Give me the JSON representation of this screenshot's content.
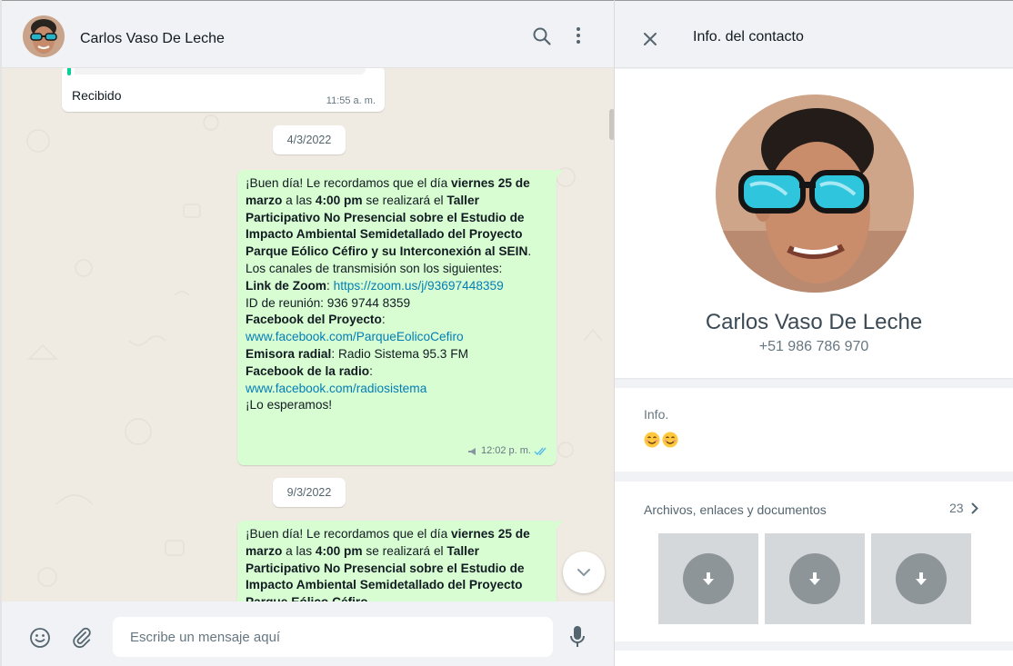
{
  "chat": {
    "contact_name": "Carlos Vaso De Leche",
    "incoming": {
      "text": "Recibido",
      "time": "11:55 a. m."
    },
    "date_chips": [
      "4/3/2022",
      "9/3/2022"
    ],
    "message1": {
      "p1": "¡Buen día! Le recordamos que el día ",
      "b1": "viernes 25 de marzo",
      "p2": " a las ",
      "b2": "4:00 pm",
      "p3": " se realizará el ",
      "b3": "Taller Participativo No Presencial sobre el Estudio de Impacto Ambiental Semidetallado del Proyecto Parque Eólico Céfiro y su Interconexión al SEIN",
      "p4": ".",
      "channels": "Los canales de transmisión son los siguientes:",
      "zoom_label": "Link de Zoom",
      "zoom_link": "https://zoom.us/j/93697448359",
      "meeting_id": "ID de reunión: 936 9744 8359",
      "fb_project_label": "Facebook del Proyecto",
      "fb_project_link": "www.facebook.com/ParqueEolicoCefiro",
      "radio_label": "Emisora radial",
      "radio_value": ": Radio Sistema 95.3 FM",
      "fb_radio_label": "Facebook de la radio",
      "fb_radio_link": "www.facebook.com/radiosistema",
      "closing": "¡Lo esperamos!",
      "time": "12:02 p. m."
    },
    "message2": {
      "p1": "¡Buen día! Le recordamos que el día ",
      "b1": "viernes 25 de marzo",
      "p2": " a las ",
      "b2": "4:00 pm",
      "p3": " se realizará el ",
      "b3": "Taller Participativo No Presencial sobre el Estudio de Impacto Ambiental Semidetallado del Proyecto Parque Eólico Céfiro"
    },
    "composer_placeholder": "Escribe un mensaje aquí"
  },
  "info": {
    "title": "Info. del contacto",
    "name": "Carlos Vaso De Leche",
    "phone": "+51 986 786 970",
    "about_label": "Info.",
    "about_emojis": [
      "😊",
      "😊"
    ],
    "media_label": "Archivos, enlaces y documentos",
    "media_count": "23"
  },
  "colors": {
    "outgoing_bubble": "#d9fdd3",
    "chat_background": "#efeae2",
    "link": "#027eb5",
    "read_ticks": "#53bdeb",
    "panel_background": "#f0f2f5"
  },
  "icons": [
    "search-icon",
    "menu-icon",
    "close-icon",
    "emoji-icon",
    "attach-icon",
    "mic-icon",
    "chevron-down-icon",
    "chevron-right-icon",
    "download-icon",
    "broadcast-icon",
    "double-check-icon"
  ]
}
